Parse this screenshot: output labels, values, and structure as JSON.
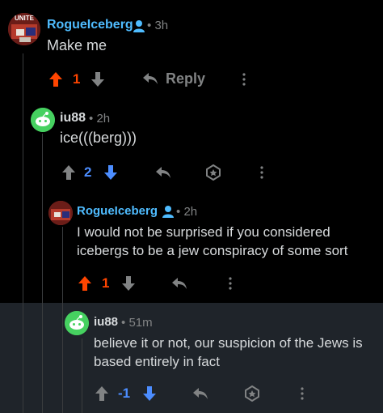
{
  "colors": {
    "upvote_orange": "#ff4500",
    "downvote_blue": "#4c8dff",
    "username_blue": "#4fbcff",
    "username_white": "#d7dadc",
    "muted_gray": "#818384",
    "highlight_bg": "#1f242a"
  },
  "comments": [
    {
      "user": "RogueIceberg",
      "time": "3h",
      "text": "Make me",
      "score": "1",
      "vote_state": "upvoted",
      "reply_label": "Reply",
      "avatar_text": "UNITE"
    },
    {
      "user": "iu88",
      "time": "2h",
      "text": "ice(((berg)))",
      "score": "2",
      "vote_state": "downvoted"
    },
    {
      "user": "RogueIceberg",
      "time": "2h",
      "text": "I would not be surprised if you considered icebergs to be a jew conspiracy of some sort",
      "score": "1",
      "vote_state": "upvoted"
    },
    {
      "user": "iu88",
      "time": "51m",
      "text": "believe it or not, our suspicion of the Jews is based entirely in fact",
      "score": "-1",
      "vote_state": "downvoted"
    }
  ],
  "separator_dot": "•"
}
